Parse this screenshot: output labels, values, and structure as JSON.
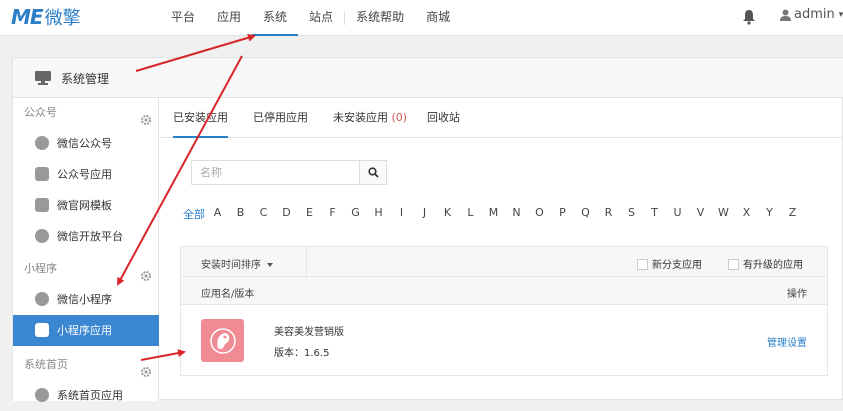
{
  "brand": {
    "mark": "ME",
    "name": "微擎"
  },
  "nav": {
    "items": [
      {
        "label": "平台"
      },
      {
        "label": "应用"
      },
      {
        "label": "系统"
      },
      {
        "label": "站点"
      },
      {
        "label": "系统帮助"
      },
      {
        "label": "商城"
      }
    ],
    "active": "系统"
  },
  "user": {
    "name": "admin"
  },
  "panel": {
    "title": "系统管理"
  },
  "sidebar": {
    "groups": [
      {
        "title": "公众号",
        "items": [
          {
            "label": "微信公众号"
          },
          {
            "label": "公众号应用"
          },
          {
            "label": "微官网模板"
          },
          {
            "label": "微信开放平台"
          }
        ]
      },
      {
        "title": "小程序",
        "items": [
          {
            "label": "微信小程序"
          },
          {
            "label": "小程序应用"
          }
        ]
      },
      {
        "title": "系统首页",
        "items": [
          {
            "label": "系统首页应用"
          }
        ]
      }
    ],
    "active": "小程序应用"
  },
  "tabs": {
    "installed": "已安装应用",
    "disabled": "已停用应用",
    "uninstalled": "未安装应用",
    "uninstalled_count": "(0)",
    "recycle": "回收站"
  },
  "search": {
    "placeholder": "名称"
  },
  "letters": {
    "all": "全部",
    "list": [
      "A",
      "B",
      "C",
      "D",
      "E",
      "F",
      "G",
      "H",
      "I",
      "J",
      "K",
      "L",
      "M",
      "N",
      "O",
      "P",
      "Q",
      "R",
      "S",
      "T",
      "U",
      "V",
      "W",
      "X",
      "Y",
      "Z"
    ]
  },
  "table": {
    "sort_label": "安装时间排序",
    "filter_branch": "新分支应用",
    "filter_upgrade": "有升级的应用",
    "col_name": "应用名/版本",
    "col_action": "操作",
    "rows": [
      {
        "name": "美容美发营销版",
        "version": "版本：1.6.5",
        "action": "管理设置"
      }
    ]
  },
  "colors": {
    "accent": "#2a7fc8",
    "active_side": "#3a86d1",
    "arrow": "#d9262b",
    "app_icon": "#f08a93"
  }
}
